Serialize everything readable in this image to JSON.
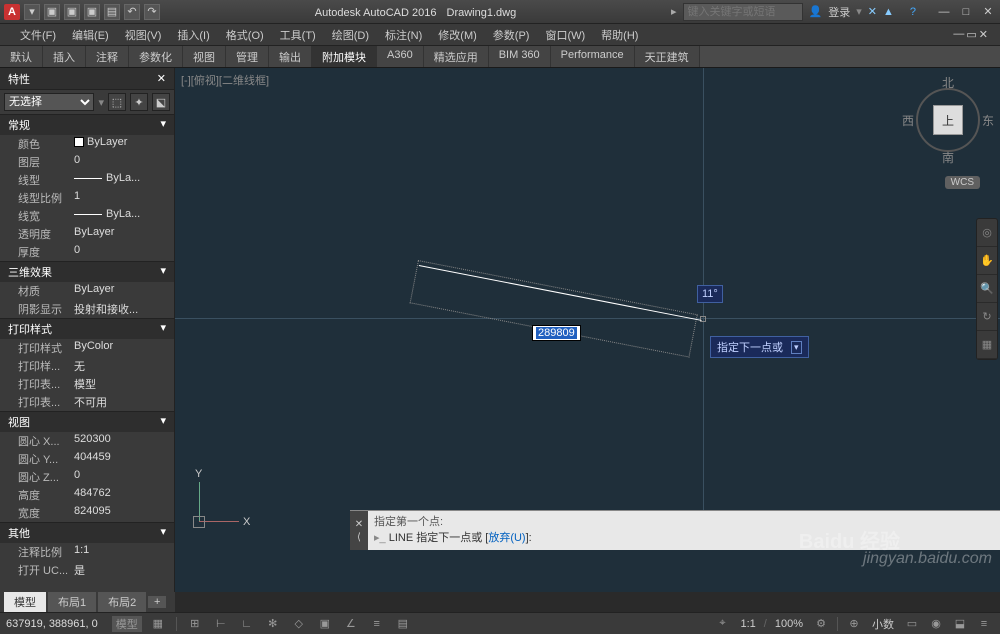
{
  "title": {
    "app": "Autodesk AutoCAD 2016",
    "doc": "Drawing1.dwg",
    "search_placeholder": "键入关键字或短语",
    "login": "登录"
  },
  "menus": [
    "文件(F)",
    "编辑(E)",
    "视图(V)",
    "插入(I)",
    "格式(O)",
    "工具(T)",
    "绘图(D)",
    "标注(N)",
    "修改(M)",
    "参数(P)",
    "窗口(W)",
    "帮助(H)"
  ],
  "ribbon_tabs": [
    "默认",
    "插入",
    "注释",
    "参数化",
    "视图",
    "管理",
    "输出",
    "附加模块",
    "A360",
    "精选应用",
    "BIM 360",
    "Performance",
    "天正建筑"
  ],
  "ribbon_active": 7,
  "props": {
    "title": "特性",
    "selection": "无选择",
    "sections": {
      "general": {
        "label": "常规",
        "rows": [
          {
            "k": "颜色",
            "v": "ByLayer",
            "swatch": true
          },
          {
            "k": "图层",
            "v": "0"
          },
          {
            "k": "线型",
            "v": "ByLa...",
            "line": true
          },
          {
            "k": "线型比例",
            "v": "1"
          },
          {
            "k": "线宽",
            "v": "ByLa...",
            "line": true
          },
          {
            "k": "透明度",
            "v": "ByLayer"
          },
          {
            "k": "厚度",
            "v": "0"
          }
        ]
      },
      "effect3d": {
        "label": "三维效果",
        "rows": [
          {
            "k": "材质",
            "v": "ByLayer"
          },
          {
            "k": "阴影显示",
            "v": "投射和接收..."
          }
        ]
      },
      "plotstyle": {
        "label": "打印样式",
        "rows": [
          {
            "k": "打印样式",
            "v": "ByColor"
          },
          {
            "k": "打印样...",
            "v": "无"
          },
          {
            "k": "打印表...",
            "v": "模型"
          },
          {
            "k": "打印表...",
            "v": "不可用"
          }
        ]
      },
      "view": {
        "label": "视图",
        "rows": [
          {
            "k": "圆心 X...",
            "v": "520300"
          },
          {
            "k": "圆心 Y...",
            "v": "404459"
          },
          {
            "k": "圆心 Z...",
            "v": "0"
          },
          {
            "k": "高度",
            "v": "484762"
          },
          {
            "k": "宽度",
            "v": "824095"
          }
        ]
      },
      "other": {
        "label": "其他",
        "rows": [
          {
            "k": "注释比例",
            "v": "1:1"
          },
          {
            "k": "打开 UC...",
            "v": "是"
          }
        ]
      }
    }
  },
  "canvas": {
    "viewport_label": "[-][俯视][二维线框]",
    "dynamic_input": "289809",
    "angle": "11°",
    "prompt": "指定下一点或",
    "ucs": {
      "x": "X",
      "y": "Y"
    },
    "viewcube": {
      "top": "上",
      "n": "北",
      "s": "南",
      "e": "东",
      "w": "西"
    },
    "wcs": "WCS"
  },
  "cmd": {
    "history": "指定第一个点:",
    "prompt_prefix": "LINE 指定下一点或 [",
    "prompt_keyword": "放弃(U)",
    "prompt_suffix": "]:"
  },
  "model_tabs": [
    "模型",
    "布局1",
    "布局2"
  ],
  "status": {
    "coords": "637919, 388961, 0",
    "model": "模型",
    "scale": "1:1",
    "zoom": "100%",
    "decimal": "小数"
  },
  "watermark": "jingyan.baidu.com",
  "watermark_logo": "Baidu 经验"
}
